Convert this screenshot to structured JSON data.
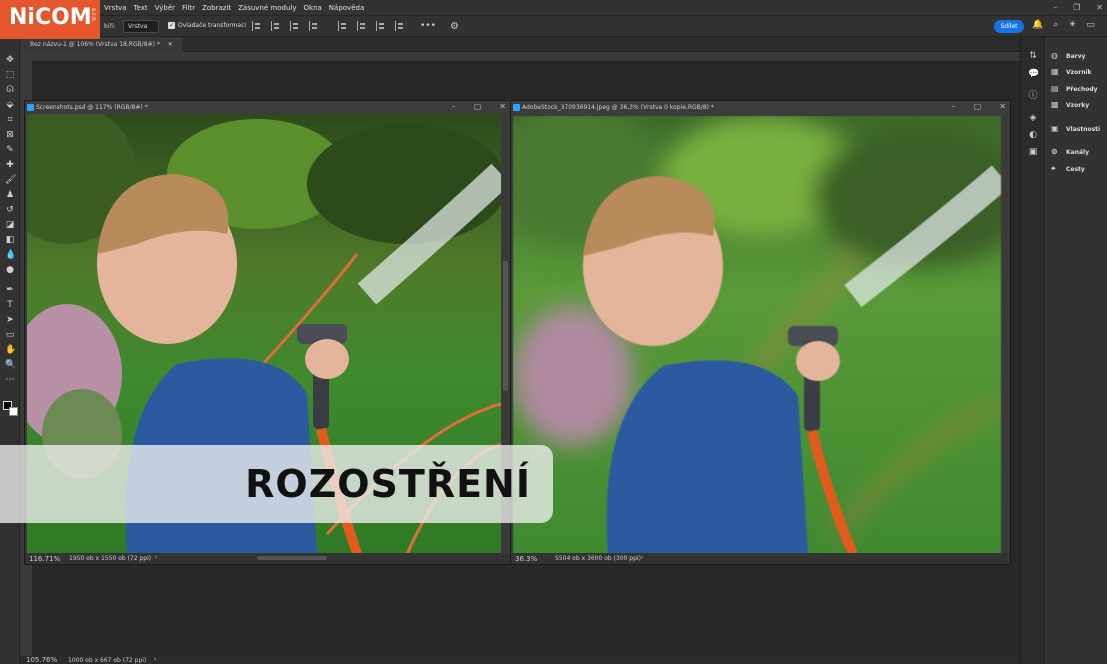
{
  "logo": {
    "text": "NiCOM",
    "tm": "s.r.o."
  },
  "menu": [
    "Vrstva",
    "Text",
    "Výběr",
    "Filtr",
    "Zobrazit",
    "Zásuvné moduly",
    "Okna",
    "Nápověda"
  ],
  "options": {
    "label": "bíři:",
    "select_value": "Vrstva",
    "checkbox_label": "Ovladače transformací",
    "share": "Sdílet"
  },
  "doc_tab": "Bez názvu-1 @ 106% (Vrstva 18,RGB/8#) *",
  "left_window": {
    "title": "Screenshots.psd @ 117% (RGB/8#) *",
    "zoom": "116.71%",
    "dims": "1950 ob x 1550 ob (72 ppi)"
  },
  "right_window": {
    "title": "AdobeStock_370936914.jpeg @ 36,3% (Vrstva 0 kopie,RGB/8) *",
    "zoom": "36.3%",
    "dims": "5504 ob x 3600 ob (300 ppi)"
  },
  "bottom": {
    "zoom": "105.76%",
    "dims": "1000 ob x 667 ob (72 ppi)"
  },
  "panels": [
    "Barvy",
    "Vzorník",
    "Přechody",
    "Vzorky",
    "Vlastnosti",
    "Kanály",
    "Cesty"
  ],
  "banner": "ROZOSTŘENÍ",
  "colors": {
    "accent": "#1473e6",
    "logo": "#e4572e"
  }
}
